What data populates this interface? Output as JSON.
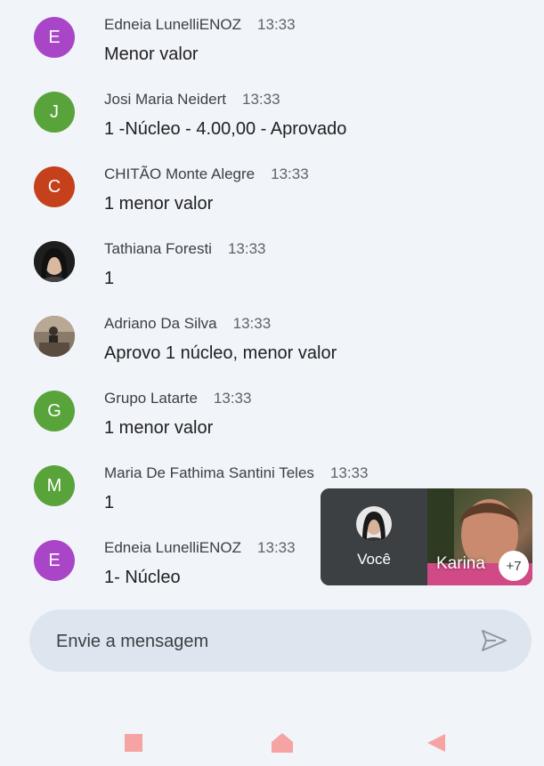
{
  "messages": [
    {
      "sender": "Edneia LunelliENOZ",
      "time": "13:33",
      "text": "Menor valor",
      "avatar_letter": "E",
      "avatar_color": "#a846c7"
    },
    {
      "sender": "Josi Maria Neidert",
      "time": "13:33",
      "text": "1 -Núcleo - 4.00,00 - Aprovado",
      "avatar_letter": "J",
      "avatar_color": "#58a43a"
    },
    {
      "sender": "CHITÃO Monte Alegre",
      "time": "13:33",
      "text": "1 menor valor",
      "avatar_letter": "C",
      "avatar_color": "#c4411c"
    },
    {
      "sender": "Tathiana Foresti",
      "time": "13:33",
      "text": "1",
      "avatar_letter": "",
      "avatar_color": "#2b2b2b"
    },
    {
      "sender": "Adriano Da Silva",
      "time": "13:33",
      "text": "Aprovo 1 núcleo, menor valor",
      "avatar_letter": "",
      "avatar_color": "#6d6258"
    },
    {
      "sender": "Grupo Latarte",
      "time": "13:33",
      "text": "1 menor valor",
      "avatar_letter": "G",
      "avatar_color": "#58a43a"
    },
    {
      "sender": "Maria De Fathima Santini Teles",
      "time": "13:33",
      "text": "1",
      "avatar_letter": "M",
      "avatar_color": "#58a43a"
    },
    {
      "sender": "Edneia LunelliENOZ",
      "time": "13:33",
      "text": "1- Núcleo",
      "avatar_letter": "E",
      "avatar_color": "#a846c7"
    }
  ],
  "video": {
    "self_label": "Você",
    "other_label": "Karina",
    "more_count": "+7"
  },
  "composer": {
    "placeholder": "Envie a mensagem",
    "send_icon": "send-icon"
  },
  "navbar": {
    "icons": [
      "recent-apps-icon",
      "home-icon",
      "back-icon"
    ],
    "color": "#f6a3a3"
  }
}
